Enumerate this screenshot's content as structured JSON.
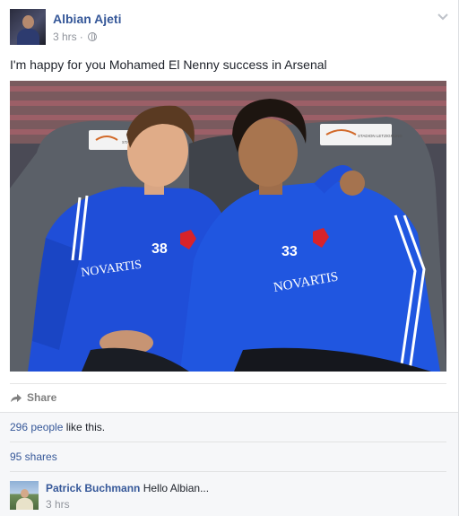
{
  "post": {
    "author": "Albian Ajeti",
    "timestamp": "3 hrs",
    "separator": "·",
    "privacy_icon": "globe-icon",
    "menu_icon": "chevron-down-icon",
    "message": "I'm happy for you Mohamed El Nenny success in Arsenal",
    "photo": {
      "banner_text": "STADION LETZIGRUND",
      "left_player_number": "38",
      "right_player_number": "33",
      "sponsor": "NOVARTIS"
    }
  },
  "actions": {
    "share_label": "Share",
    "share_icon": "share-arrow-icon"
  },
  "engagement": {
    "likes_link": "296 people",
    "likes_suffix": " like this.",
    "shares": "95 shares"
  },
  "comment": {
    "author": "Patrick Buchmann",
    "text": "Hello Albian...",
    "timestamp": "3 hrs"
  },
  "colors": {
    "link_blue": "#365899",
    "meta_gray": "#90949c",
    "jersey_blue": "#1f4ed8",
    "ufi_bg": "#f6f7f9"
  }
}
